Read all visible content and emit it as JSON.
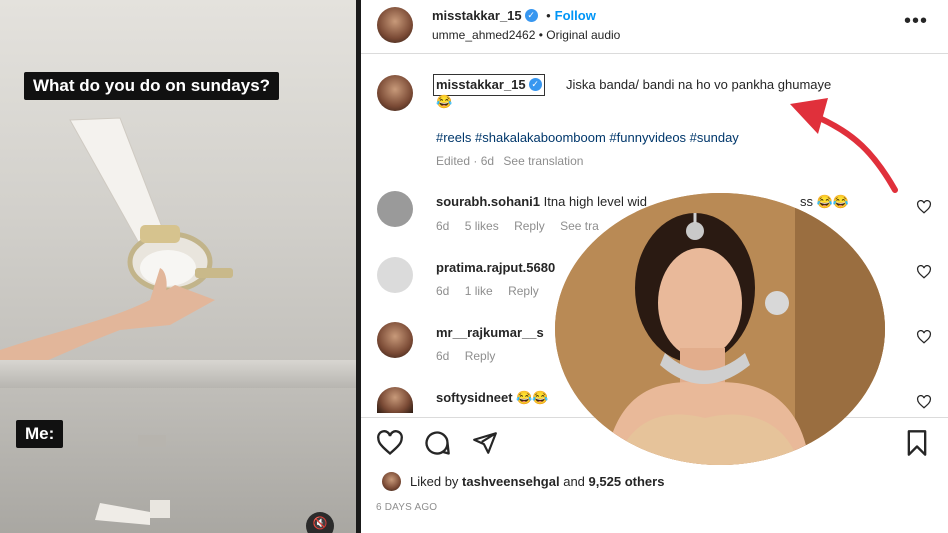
{
  "video": {
    "caption_top": "What do you do on sundays?",
    "caption_me": "Me:",
    "mute_icon": "muted-speaker-icon"
  },
  "header": {
    "username": "misstakkar_15",
    "follow_label": "Follow",
    "audio_user": "umme_ahmed2462",
    "audio_label": "Original audio",
    "more_icon": "more-horizontal-icon"
  },
  "caption": {
    "username": "misstakkar_15",
    "text": "Jiska banda/ bandi na ho vo pankha ghumaye",
    "emoji": "😂",
    "hashtags": "#reels #shakalakaboomboom #funnyvideos #sunday",
    "edited": "Edited · 6d",
    "see_translation": "See translation"
  },
  "comments": [
    {
      "username": "sourabh.sohani1",
      "text": "Itna high level wid",
      "suffix": "ss 😂😂",
      "time": "6d",
      "likes": "5 likes",
      "reply": "Reply",
      "extra": "See tra"
    },
    {
      "username": "pratima.rajput.5680",
      "text": "",
      "time": "6d",
      "likes": "1 like",
      "reply": "Reply"
    },
    {
      "username": "mr__rajkumar__s",
      "text": "",
      "time": "6d",
      "reply": "Reply"
    },
    {
      "username": "softysidneet",
      "text": "😂😂",
      "time": "",
      "reply": ""
    }
  ],
  "actions": {
    "like_icon": "heart-icon",
    "comment_icon": "comment-icon",
    "share_icon": "send-icon",
    "save_icon": "bookmark-icon"
  },
  "likes": {
    "prefix": "Liked by",
    "user": "tashveensehgal",
    "and": "and",
    "count": "9,525 others"
  },
  "posted": "6 DAYS AGO",
  "colors": {
    "verified": "#3897f0",
    "follow": "#0095f6",
    "arrow": "#e0303b",
    "link": "#00376b",
    "muted": "#8e8e8e"
  }
}
